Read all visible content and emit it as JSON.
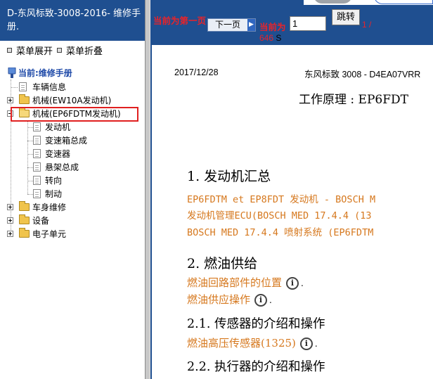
{
  "left": {
    "title": "D-东风标致-3008-2016- 维修手册.",
    "menu_expand": "菜单展开",
    "menu_collapse": "菜单折叠",
    "tree": {
      "root": "当前:维修手册",
      "vehicle_info": "车辆信息",
      "ew10a": "机械(EW10A发动机)",
      "ep6fdtm": "机械(EP6FDTM发动机)",
      "children": [
        "发动机",
        "变速箱总成",
        "变速器",
        "悬架总成",
        "转向",
        "制动"
      ],
      "body_repair": "车身维修",
      "equipment": "设备",
      "electronics": "电子单元"
    }
  },
  "toolbar": {
    "first_page_note": "当前为第一页",
    "next_label": "下一页",
    "current_label": "当前为",
    "page_value": "1",
    "jump_label": "跳转",
    "page_of": "1 /",
    "total_pages": "646",
    "total_suffix": "S"
  },
  "document": {
    "date": "2017/12/28",
    "model": "东风标致 3008 - D4EA07VRR",
    "heading": "工作原理 : EP6FDT",
    "section1": "1. 发动机汇总",
    "line1": "EP6FDTM et EP8FDT 发动机 - BOSCH M",
    "line2": "发动机管理ECU(BOSCH MED 17.4.4 (13",
    "line3": "BOSCH MED 17.4.4 喷射系统 (EP6FDTM",
    "section2": "2. 燃油供给",
    "link1": "燃油回路部件的位置",
    "link2": "燃油供应操作",
    "section21": "2.1. 传感器的介绍和操作",
    "link3": "燃油高压传感器(1325)",
    "section22": "2.2. 执行器的介绍和操作",
    "info_glyph": "i",
    "period": "."
  },
  "colors": {
    "header_blue": "#1f4f90",
    "red": "#e8232a",
    "orange_link": "#d6781e",
    "highlight_box": "#e02020"
  },
  "icons": [
    "root-manual-icon",
    "document-icon",
    "folder-icon",
    "expand-icon",
    "collapse-icon",
    "info-icon",
    "next-arrow-icon"
  ]
}
